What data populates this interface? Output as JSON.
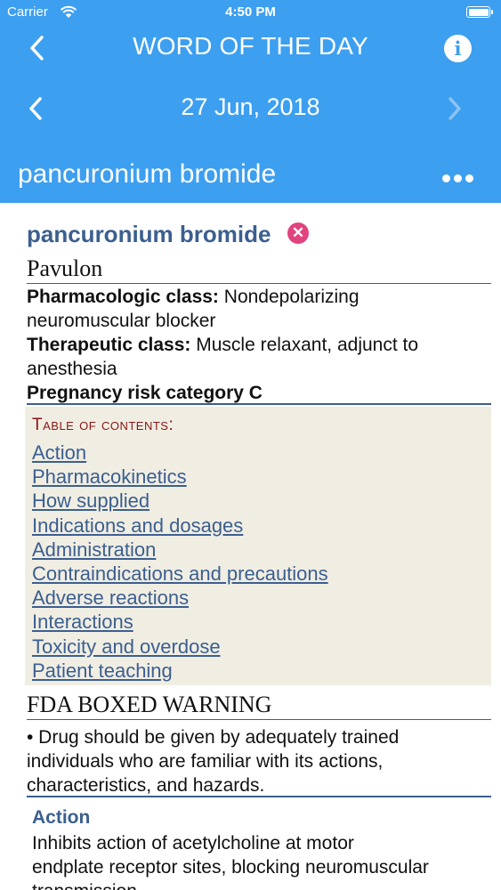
{
  "status_bar": {
    "carrier": "Carrier",
    "time": "4:50 PM"
  },
  "nav": {
    "title": "WORD OF THE DAY",
    "info_icon": "i"
  },
  "date_nav": {
    "date": "27 Jun, 2018"
  },
  "term_bar": {
    "title": "pancuronium bromide"
  },
  "drug": {
    "name": "pancuronium bromide",
    "brand": "Pavulon",
    "pharmacologic_label": "Pharmacologic class:",
    "pharmacologic_line1": " Nondepolarizing",
    "pharmacologic_line2": "neuromuscular blocker",
    "therapeutic_label": "Therapeutic class:",
    "therapeutic_line1": " Muscle relaxant, adjunct to",
    "therapeutic_line2": "anesthesia",
    "pregnancy": "Pregnancy risk category C"
  },
  "toc": {
    "heading": "Table of contents:",
    "items": [
      "Action",
      "Pharmacokinetics",
      "How supplied",
      "Indications and dosages",
      "Administration",
      "Contraindications and precautions",
      "Adverse reactions",
      "Interactions",
      "Toxicity and overdose",
      "Patient teaching"
    ]
  },
  "boxed_warning": {
    "heading": "FDA BOXED WARNING",
    "line1": "• Drug should be given by adequately trained",
    "line2": "individuals who are familiar with its actions,",
    "line3": "characteristics, and hazards."
  },
  "action_section": {
    "heading": "Action",
    "line1": "Inhibits action of acetylcholine at motor",
    "line2": "endplate receptor sites, blocking neuromuscular",
    "line3": "transmission."
  },
  "colors": {
    "header_bg": "#3d9ff0",
    "link": "#3b5f8f",
    "toc_bg": "#f0ede3",
    "toc_heading": "#8a1414",
    "warning_badge": "#e0447e"
  },
  "icons": [
    "wifi-icon",
    "battery-icon",
    "back-chevron-icon",
    "info-icon",
    "chevron-left-icon",
    "chevron-right-icon",
    "more-icon",
    "warning-x-icon"
  ]
}
